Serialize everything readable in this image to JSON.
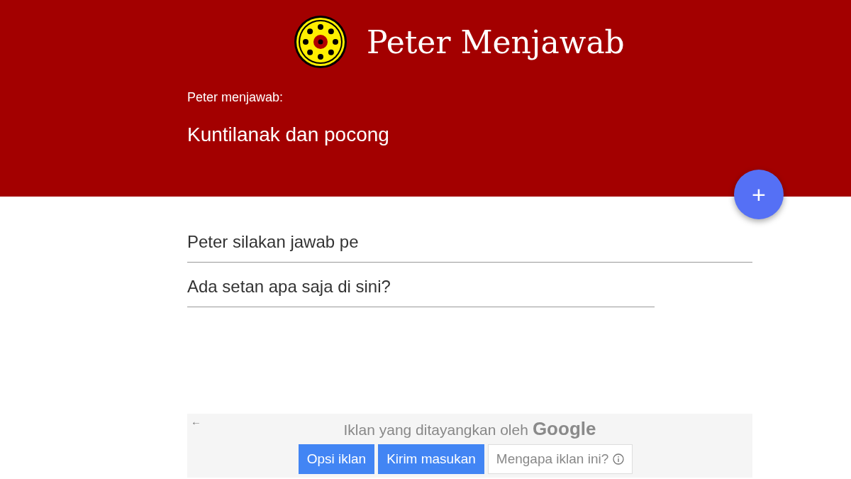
{
  "header": {
    "site_title": "Peter Menjawab",
    "label": "Peter menjawab:",
    "question": "Kuntilanak dan pocong"
  },
  "fab": {
    "label": "+"
  },
  "fields": [
    {
      "value": "Peter silakan jawab pe"
    },
    {
      "value": "Ada setan apa saja di sini?"
    }
  ],
  "ad": {
    "back": "←",
    "caption": "Iklan yang ditayangkan oleh",
    "brand": "Google",
    "buttons": [
      {
        "label": "Opsi iklan",
        "kind": "primary"
      },
      {
        "label": "Kirim masukan",
        "kind": "primary"
      },
      {
        "label": "Mengapa iklan ini?",
        "kind": "info"
      }
    ]
  }
}
